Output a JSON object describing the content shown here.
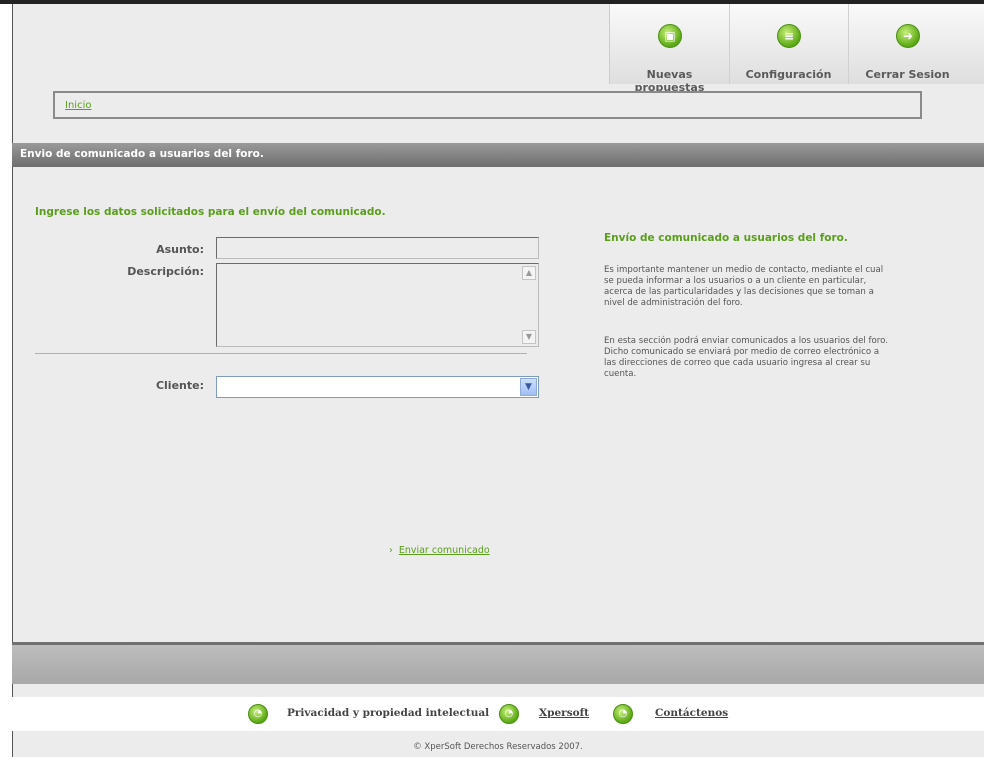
{
  "nav": [
    {
      "label": "Nuevas propuestas",
      "icon": "box-icon"
    },
    {
      "label": "Configuración",
      "icon": "document-icon"
    },
    {
      "label": "Cerrar Sesion",
      "icon": "exit-arrow-icon"
    }
  ],
  "breadcrumb": {
    "home": "Inicio"
  },
  "section": {
    "title": "Envio de comunicado a usuarios del foro."
  },
  "form": {
    "instruction": "Ingrese los datos solicitados para el envío del comunicado.",
    "asunto_label": "Asunto:",
    "asunto_value": "",
    "descripcion_label": "Descripción:",
    "descripcion_value": "",
    "cliente_label": "Cliente:",
    "cliente_value": ""
  },
  "info": {
    "title": "Envío de comunicado a usuarios del foro.",
    "p1": "Es importante mantener un medio de contacto, mediante el cual se pueda informar a los usuarios o a un cliente en particular, acerca de las particularidades y las decisiones que se toman a nivel de administración del foro.",
    "p2": "En esta sección podrá enviar comunicados a los usuarios del foro. Dicho comunicado se enviará por medio de correo electrónico a las direcciones de correo que cada usuario ingresa al crear su cuenta."
  },
  "actions": {
    "send": "Enviar comunicado"
  },
  "footer": {
    "links": [
      "Privacidad y propiedad intelectual",
      "Xpersoft",
      "Contáctenos"
    ],
    "copyright": "© XperSoft Derechos Reservados 2007."
  },
  "colors": {
    "accent": "#5a9e1c",
    "bar": "#7a7a7a"
  }
}
